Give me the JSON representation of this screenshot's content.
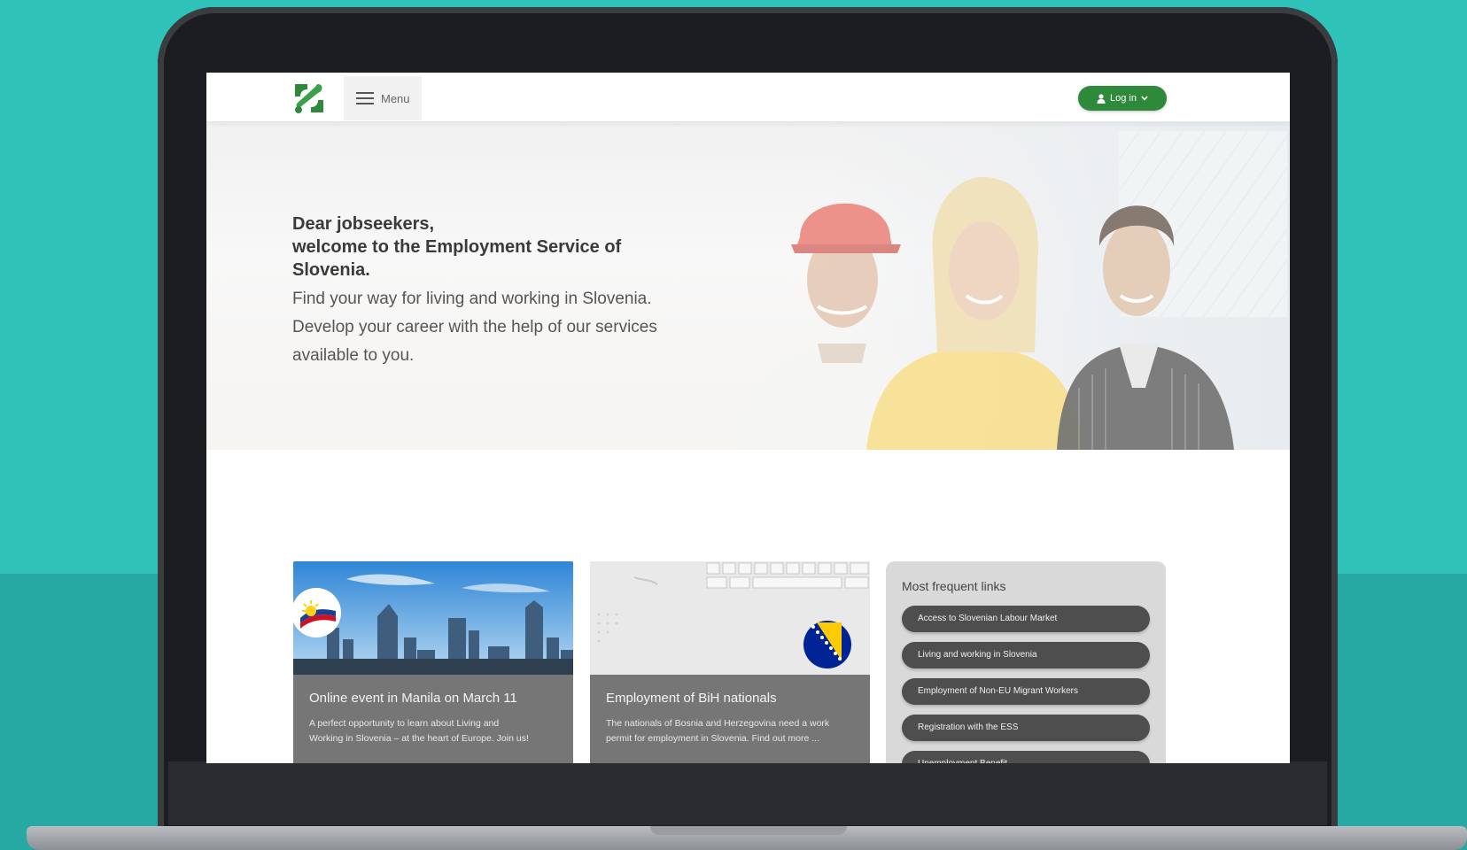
{
  "header": {
    "menu_label": "Menu",
    "login_label": "Log in",
    "brand_color": "#2e8a3a"
  },
  "hero": {
    "title_lines": [
      "Dear jobseekers,",
      "welcome to the Employment Service of",
      "Slovenia."
    ],
    "subtitle_lines": [
      "Find your way for living and working in Slovenia.",
      "Develop your career with the help of our services",
      "available to you."
    ]
  },
  "cards": [
    {
      "title": "Online event in Manila on March 11",
      "text_lines": [
        "A perfect opportunity to learn about Living and",
        "Working in Slovenia – at the heart of Europe. Join us!"
      ],
      "icon": "philippines-flag-icon"
    },
    {
      "title": "Employment of BiH nationals",
      "text_lines": [
        "The nationals of Bosnia and Herzegovina need a work",
        "permit for employment in Slovenia. Find out more ..."
      ],
      "icon": "bih-flag-icon"
    }
  ],
  "frequent_links": {
    "title": "Most frequent links",
    "items": [
      "Access to Slovenian Labour Market",
      "Living and working in Slovenia",
      "Employment of Non-EU Migrant Workers",
      "Registration with the ESS",
      "Unemployment Benefit"
    ]
  },
  "colors": {
    "background": "#2ec2b9",
    "laptop_frame": "#1c1d20",
    "card_overlay": "#767676",
    "pill": "#4e4e4e"
  }
}
